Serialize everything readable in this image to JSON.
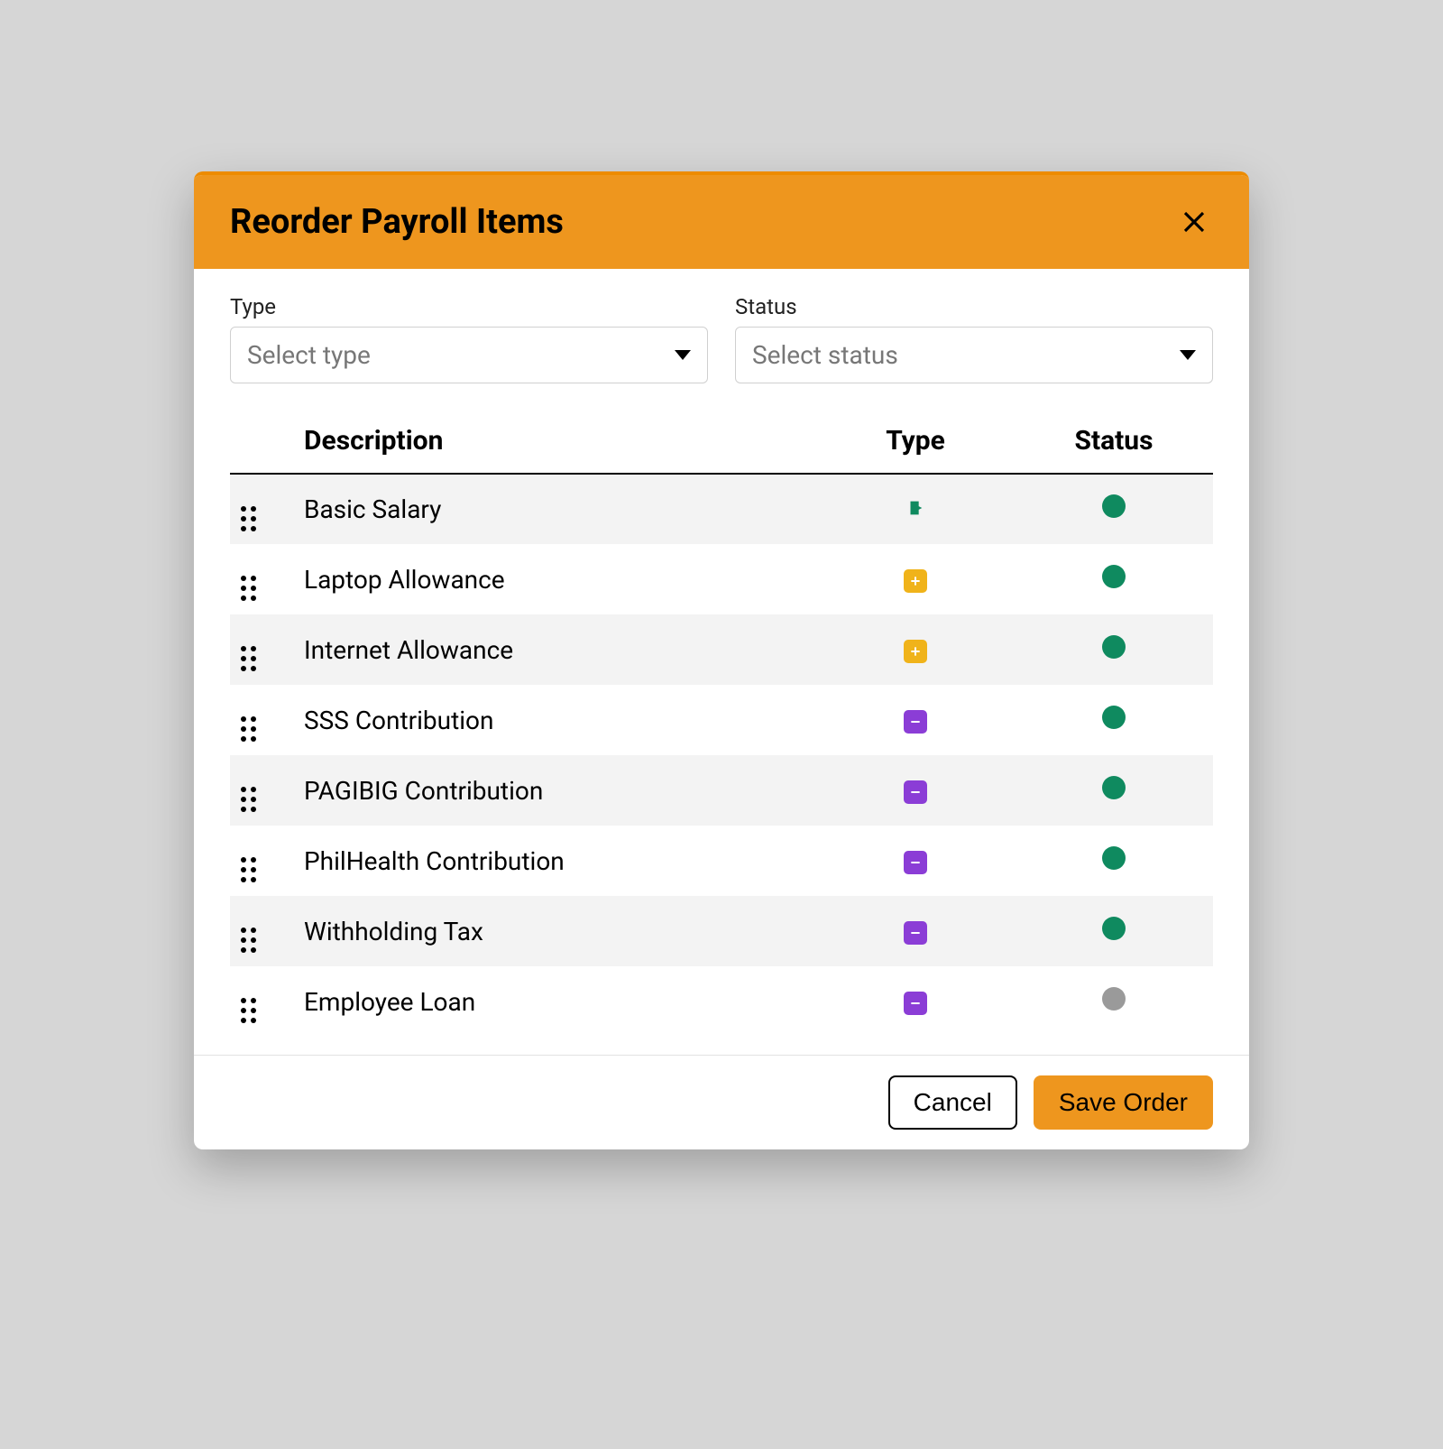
{
  "modal": {
    "title": "Reorder Payroll Items"
  },
  "filters": {
    "type": {
      "label": "Type",
      "placeholder": "Select type"
    },
    "status": {
      "label": "Status",
      "placeholder": "Select status"
    }
  },
  "table": {
    "headers": {
      "description": "Description",
      "type": "Type",
      "status": "Status"
    },
    "rows": [
      {
        "description": "Basic Salary",
        "type": "basic",
        "status": "active"
      },
      {
        "description": "Laptop Allowance",
        "type": "plus",
        "status": "active"
      },
      {
        "description": "Internet Allowance",
        "type": "plus",
        "status": "active"
      },
      {
        "description": "SSS Contribution",
        "type": "minus",
        "status": "active"
      },
      {
        "description": "PAGIBIG Contribution",
        "type": "minus",
        "status": "active"
      },
      {
        "description": "PhilHealth Contribution",
        "type": "minus",
        "status": "active"
      },
      {
        "description": "Withholding Tax",
        "type": "minus",
        "status": "active"
      },
      {
        "description": "Employee Loan",
        "type": "minus",
        "status": "inactive"
      }
    ]
  },
  "footer": {
    "cancel": "Cancel",
    "save": "Save Order"
  }
}
